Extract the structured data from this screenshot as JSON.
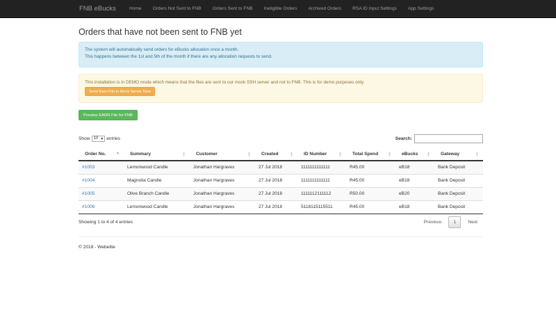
{
  "nav": {
    "brand": "FNB eBucks",
    "items": [
      "Home",
      "Orders Not Sent to FNB",
      "Orders Sent to FNB",
      "Ineligible Orders",
      "Archived Orders",
      "RSA ID Input Settings",
      "App Settings"
    ]
  },
  "page": {
    "title": "Orders that have not been sent to FNB yet"
  },
  "info_alert": {
    "line1": "The system will automatically send orders for eBucks allocation once a month.",
    "line2": "This happens between the 1st and 5th of the month if there are any allocation requests to send."
  },
  "demo_alert": {
    "text": "This installation is in DEMO mode which means that the files are sent to our mock SSH server and not to FNB. This is for demo purposes only.",
    "button": "Send Earn File to Mock Server Now"
  },
  "preview_button": "Preview EARN File for FNB",
  "datatable": {
    "show": "Show",
    "entries_value": "10",
    "entries": "entries",
    "search_label": "Search:",
    "columns": [
      "Order No.",
      "Summary",
      "Customer",
      "Created",
      "ID Number",
      "Total Spend",
      "eBucks",
      "Gateway"
    ],
    "rows": [
      [
        "#1003",
        "Lemonwood Candle",
        "Jonathan Hargraves",
        "27 Jul 2018",
        "1111111111111",
        "R45.00",
        "eB18",
        "Bank Deposit"
      ],
      [
        "#1004",
        "Magnolia Candle",
        "Jonathan Hargraves",
        "27 Jul 2018",
        "1111111111111",
        "R45.00",
        "eB18",
        "Bank Deposit"
      ],
      [
        "#1005",
        "Olive Branch Candle",
        "Jonathan Hargraves",
        "27 Jul 2018",
        "1111112111112",
        "R50.00",
        "eB20",
        "Bank Deposit"
      ],
      [
        "#1006",
        "Lemonwood Candle",
        "Jonathan Hargraves",
        "27 Jul 2018",
        "5118115115511",
        "R45.00",
        "eB18",
        "Bank Deposit"
      ]
    ],
    "info": "Showing 1 to 4 of 4 entries",
    "previous": "Previous",
    "page": "1",
    "next": "Next"
  },
  "footer": "© 2018 - Webelite"
}
